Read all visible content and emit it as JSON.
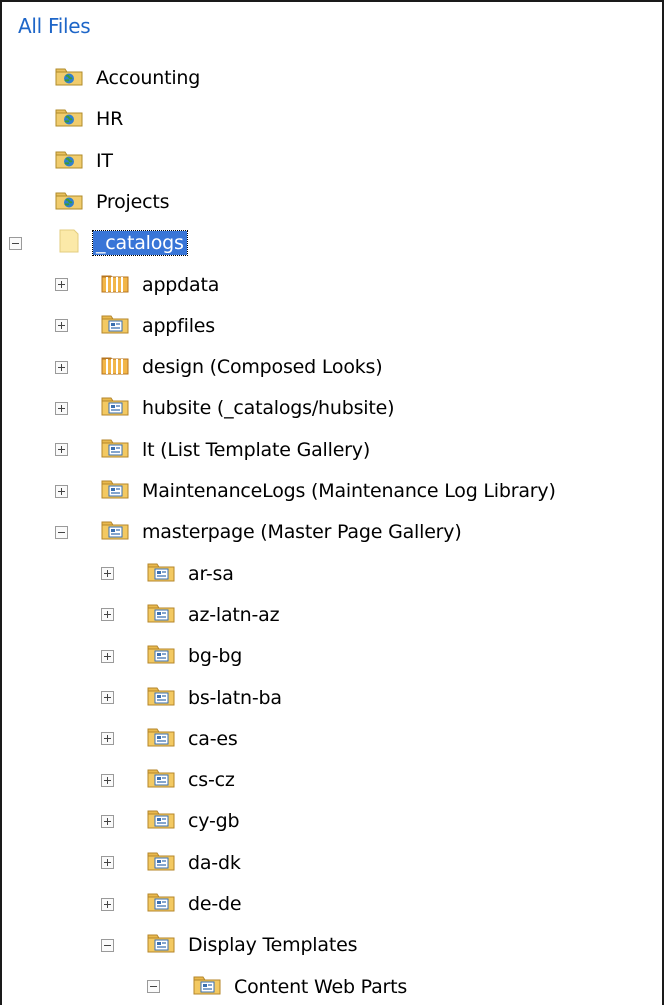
{
  "header": {
    "title": "All Files"
  },
  "tree": [
    {
      "label": "Accounting",
      "level": 0,
      "toggle": "none",
      "icon": "site-folder-icon"
    },
    {
      "label": "HR",
      "level": 0,
      "toggle": "none",
      "icon": "site-folder-icon"
    },
    {
      "label": "IT",
      "level": 0,
      "toggle": "none",
      "icon": "site-folder-icon"
    },
    {
      "label": "Projects",
      "level": 0,
      "toggle": "none",
      "icon": "site-folder-icon"
    },
    {
      "label": "_catalogs",
      "level": 0,
      "toggle": "minus",
      "icon": "plain-folder-icon",
      "selected": true
    },
    {
      "label": "appdata",
      "level": 1,
      "toggle": "plus",
      "icon": "list-folder-icon"
    },
    {
      "label": "appfiles",
      "level": 1,
      "toggle": "plus",
      "icon": "library-folder-icon"
    },
    {
      "label": "design (Composed Looks)",
      "level": 1,
      "toggle": "plus",
      "icon": "list-folder-icon"
    },
    {
      "label": "hubsite (_catalogs/hubsite)",
      "level": 1,
      "toggle": "plus",
      "icon": "library-folder-icon"
    },
    {
      "label": "lt (List Template Gallery)",
      "level": 1,
      "toggle": "plus",
      "icon": "library-folder-icon"
    },
    {
      "label": "MaintenanceLogs (Maintenance Log Library)",
      "level": 1,
      "toggle": "plus",
      "icon": "library-folder-icon"
    },
    {
      "label": "masterpage (Master Page Gallery)",
      "level": 1,
      "toggle": "minus",
      "icon": "library-folder-icon"
    },
    {
      "label": "ar-sa",
      "level": 2,
      "toggle": "plus",
      "icon": "library-folder-icon"
    },
    {
      "label": "az-latn-az",
      "level": 2,
      "toggle": "plus",
      "icon": "library-folder-icon"
    },
    {
      "label": "bg-bg",
      "level": 2,
      "toggle": "plus",
      "icon": "library-folder-icon"
    },
    {
      "label": "bs-latn-ba",
      "level": 2,
      "toggle": "plus",
      "icon": "library-folder-icon"
    },
    {
      "label": "ca-es",
      "level": 2,
      "toggle": "plus",
      "icon": "library-folder-icon"
    },
    {
      "label": "cs-cz",
      "level": 2,
      "toggle": "plus",
      "icon": "library-folder-icon"
    },
    {
      "label": "cy-gb",
      "level": 2,
      "toggle": "plus",
      "icon": "library-folder-icon"
    },
    {
      "label": "da-dk",
      "level": 2,
      "toggle": "plus",
      "icon": "library-folder-icon"
    },
    {
      "label": "de-de",
      "level": 2,
      "toggle": "plus",
      "icon": "library-folder-icon"
    },
    {
      "label": "Display Templates",
      "level": 2,
      "toggle": "minus",
      "icon": "library-folder-icon"
    },
    {
      "label": "Content Web Parts",
      "level": 3,
      "toggle": "minus",
      "icon": "library-folder-icon"
    }
  ]
}
